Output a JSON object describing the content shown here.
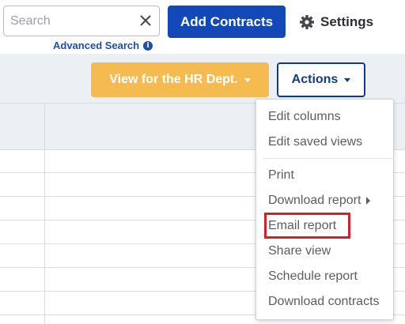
{
  "header": {
    "search": {
      "placeholder": "Search",
      "value": ""
    },
    "advanced_search_label": "Advanced Search",
    "info_icon": "info-icon",
    "add_contracts_label": "Add Contracts",
    "settings_label": "Settings"
  },
  "toolbar": {
    "view_button_label": "View for the HR Dept.",
    "actions_button_label": "Actions"
  },
  "actions_menu": {
    "items": [
      {
        "label": "Edit columns"
      },
      {
        "label": "Edit saved views"
      },
      {
        "label": "Print"
      },
      {
        "label": "Download report",
        "has_submenu": true
      },
      {
        "label": "Email report",
        "highlighted": true
      },
      {
        "label": "Share view"
      },
      {
        "label": "Schedule report"
      },
      {
        "label": "Download contracts"
      }
    ]
  },
  "colors": {
    "primary_blue": "#1248b8",
    "dark_blue": "#123c82",
    "view_button": "#f6bb50",
    "highlight_red": "#d71f2b"
  }
}
